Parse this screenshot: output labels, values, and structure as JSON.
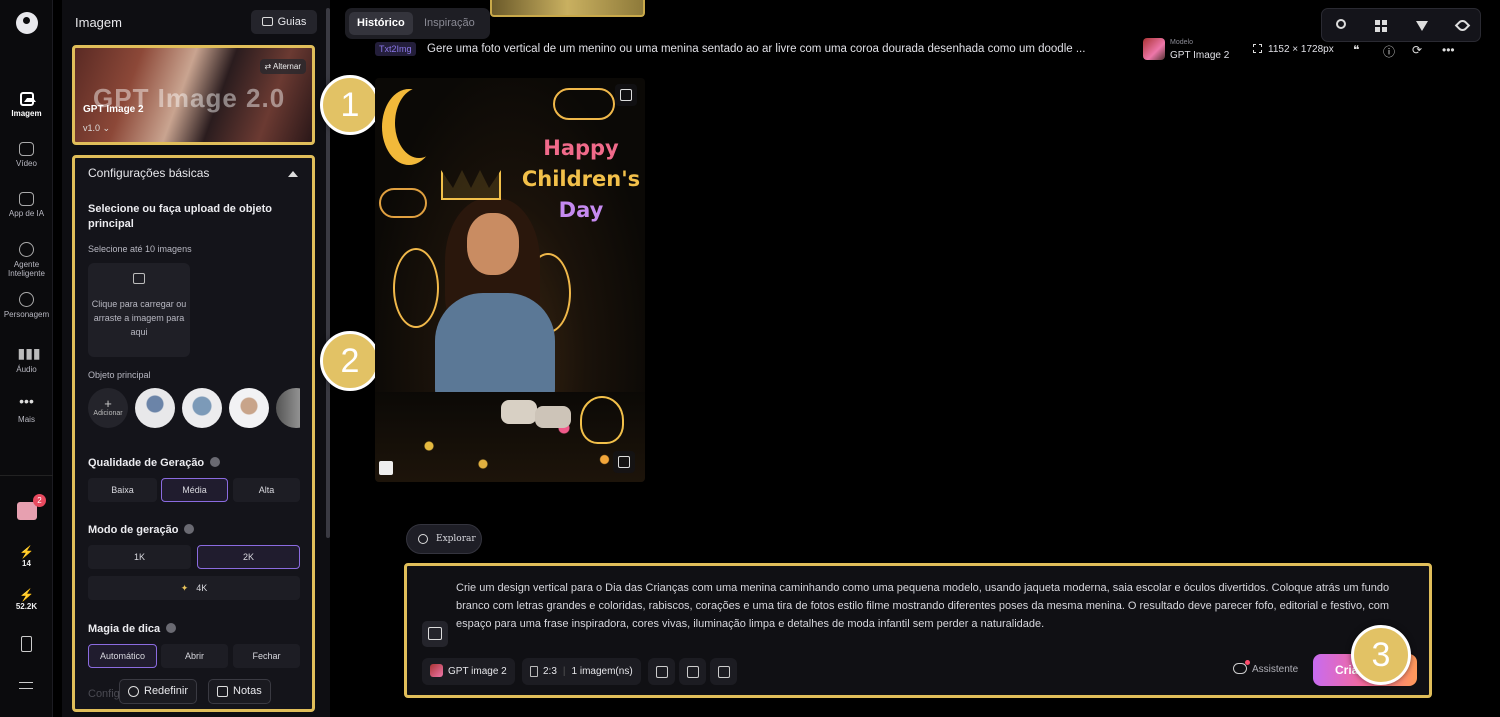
{
  "rail": {
    "items": [
      {
        "label": "Imagem",
        "icon": "image-icon"
      },
      {
        "label": "Vídeo",
        "icon": "video-icon"
      },
      {
        "label": "App de IA",
        "icon": "ai-app-icon"
      },
      {
        "label": "Agente Inteligente",
        "icon": "agent-icon"
      },
      {
        "label": "Personagem",
        "icon": "character-icon"
      },
      {
        "label": "Áudio",
        "icon": "audio-icon"
      },
      {
        "label": "Mais",
        "icon": "more-icon"
      }
    ],
    "gift_badge": "2",
    "credits_1": "14",
    "credits_2": "52.2K"
  },
  "panel": {
    "title": "Imagem",
    "guias_label": "Guias",
    "model_card": {
      "ghost_text": "GPT Image 2.0",
      "name": "GPT Image 2",
      "version": "v1.0",
      "switch_label": "Alternar"
    },
    "basic_settings": {
      "header": "Configurações básicas",
      "subject_title": "Selecione ou faça upload de objeto principal",
      "subject_hint": "Selecione até 10 imagens",
      "upload_text": "Clique para carregar ou arraste a imagem para aqui",
      "main_object_label": "Objeto principal",
      "add_label": "Adicionar",
      "quality_label": "Qualidade de Geração",
      "quality_options": [
        "Baixa",
        "Média",
        "Alta"
      ],
      "quality_selected": "Média",
      "mode_label": "Modo de geração",
      "mode_options": [
        "1K",
        "2K",
        "4K"
      ],
      "mode_selected": "2K",
      "magic_label": "Magia de dica",
      "magic_options": [
        "Automático",
        "Abrir",
        "Fechar"
      ],
      "magic_selected": "Automático",
      "next_section_ghost": "Configu"
    },
    "footer": {
      "reset_label": "Redefinir",
      "notes_label": "Notas"
    }
  },
  "markers": [
    "1",
    "2",
    "3"
  ],
  "main": {
    "tabs": [
      "Histórico",
      "Inspiração"
    ],
    "active_tab": "Histórico",
    "record": {
      "badge": "Txt2Img",
      "prompt": "Gere uma foto vertical de um menino ou uma menina sentado ao ar livre com uma coroa dourada desenhada como um doodle ...",
      "model_label": "Modelo",
      "model_value": "GPT Image 2",
      "resolution": "1152 × 1728px"
    },
    "image_text": {
      "line1": "Happy",
      "line2": "Children's",
      "line3": "Day"
    },
    "explore_label": "Explorar",
    "composer": {
      "prompt": "Crie um design vertical para o Dia das Crianças com uma menina caminhando como uma pequena modelo, usando jaqueta moderna, saia escolar e óculos divertidos. Coloque atrás um fundo branco com letras grandes e coloridas, rabiscos, corações e uma tira de fotos estilo filme mostrando diferentes poses da mesma menina. O resultado deve parecer fofo, editorial e festivo, com espaço para uma frase inspiradora, cores vivas, iluminação limpa e detalhes de moda infantil sem perder a naturalidade.",
      "model_chip": "GPT image 2",
      "ratio": "2:3",
      "count": "1 imagem(ns)",
      "assistant_label": "Assistente",
      "create_label": "Criar"
    }
  },
  "colors": {
    "highlight": "#e0be5a",
    "accent": "#8b6be0",
    "badge_text": "#8a76e8"
  }
}
